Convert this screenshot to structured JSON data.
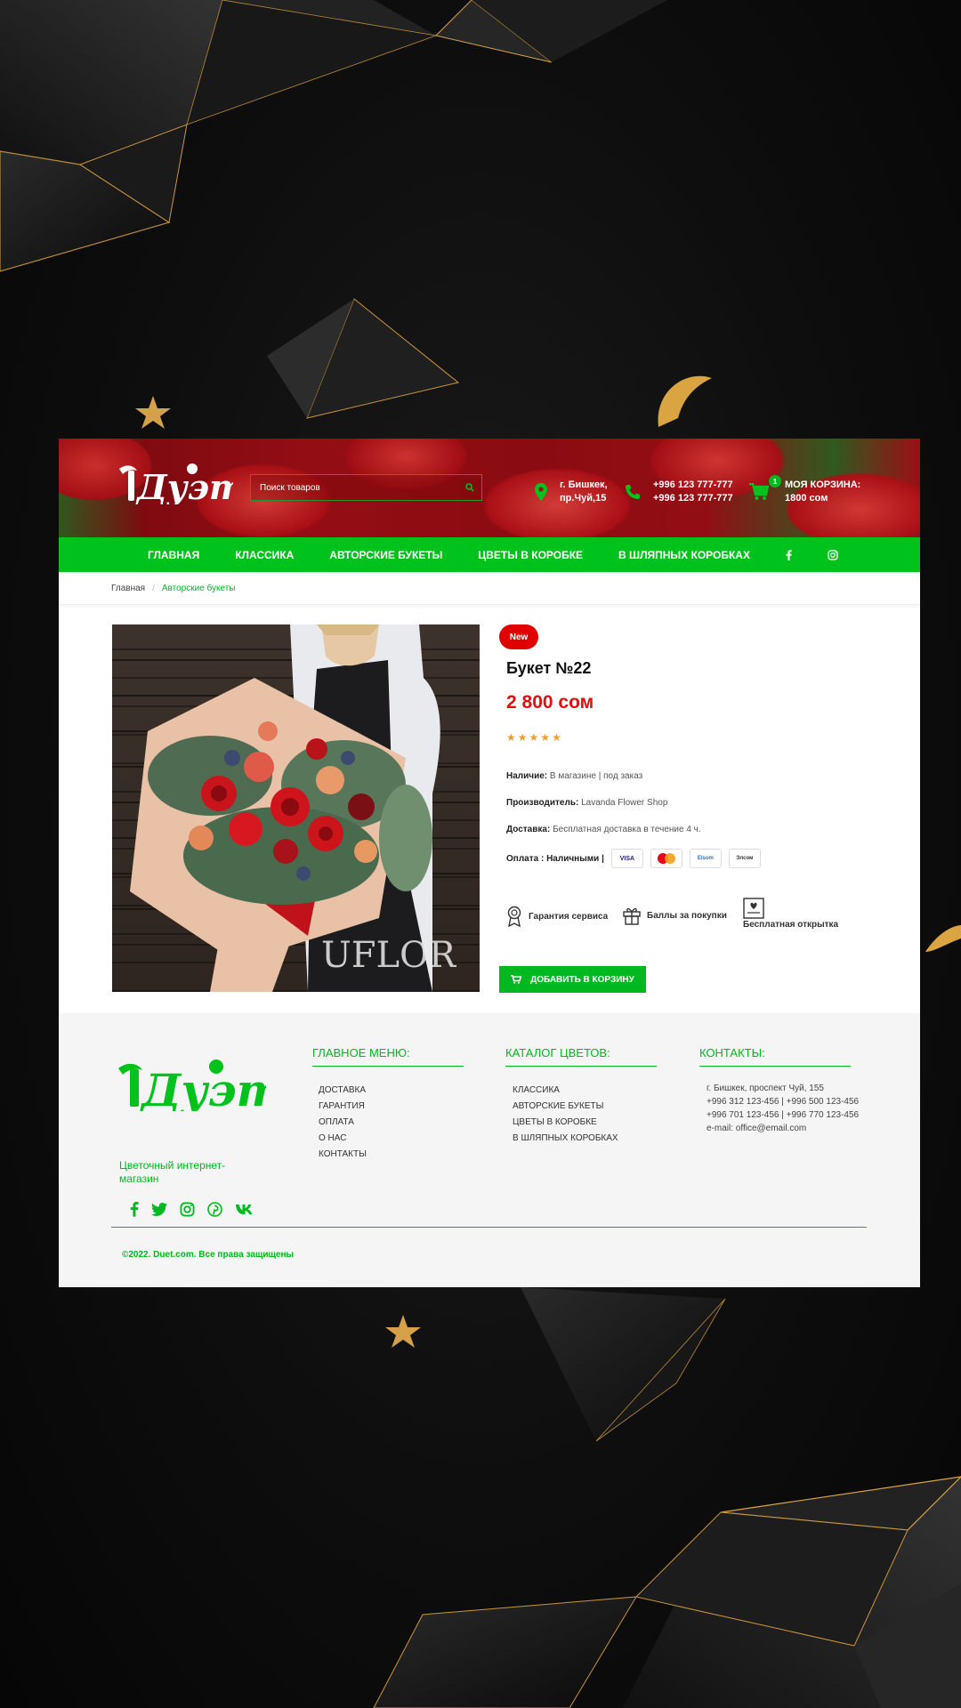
{
  "colors": {
    "accent": "#00c21c",
    "price": "#e01010",
    "badge": "#e00000",
    "gold": "#d9a441",
    "background": "#0e0e0e"
  },
  "header": {
    "logo_text": "Дуэт",
    "search_placeholder": "Поиск товаров",
    "address_line1": "г. Бишкек,",
    "address_line2": "пр.Чуй,15",
    "phone1": "+996 123 777-777",
    "phone2": "+996 123 777-777",
    "cart_title": "МОЯ КОРЗИНА:",
    "cart_total": "1800 сом",
    "cart_count": "1",
    "icons": [
      "search-icon",
      "map-pin-icon",
      "phone-icon",
      "cart-icon"
    ]
  },
  "nav": {
    "items": [
      "ГЛАВНАЯ",
      "КЛАССИКА",
      "АВТОРСКИЕ БУКЕТЫ",
      "ЦВЕТЫ В КОРОБКЕ",
      "В ШЛЯПНЫХ КОРОБКАХ"
    ],
    "social": [
      "facebook-icon",
      "instagram-icon"
    ]
  },
  "breadcrumb": {
    "home": "Главная",
    "current": "Авторские букеты"
  },
  "product": {
    "badge": "New",
    "title": "Букет №22",
    "price": "2 800 сом",
    "rating": 5,
    "availability_label": "Наличие:",
    "availability_value": "В магазине | под заказ",
    "maker_label": "Производитель:",
    "maker_value": "Lavanda Flower Shop",
    "delivery_label": "Доставка:",
    "delivery_value": "Бесплатная доставка в течение 4 ч.",
    "payment_label": "Оплата : Наличными |",
    "payment_methods": [
      "VISA",
      "MasterCard",
      "Elsom",
      "Элсом"
    ],
    "photo_watermark": "UFLOR",
    "features": [
      "Гарантия сервиса",
      "Баллы за покупки",
      "Бесплатная открытка"
    ],
    "add_to_cart": "ДОБАВИТЬ В КОРЗИНУ"
  },
  "footer": {
    "tagline": "Цветочный интернет-магазин",
    "menu_title": "ГЛАВНОЕ МЕНЮ:",
    "menu_items": [
      "ДОСТАВКА",
      "ГАРАНТИЯ",
      "ОПЛАТА",
      "О НАС",
      "КОНТАКТЫ"
    ],
    "catalog_title": "КАТАЛОГ ЦВЕТОВ:",
    "catalog_items": [
      "КЛАССИКА",
      "АВТОРСКИЕ БУКЕТЫ",
      "ЦВЕТЫ В КОРОБКЕ",
      "В ШЛЯПНЫХ КОРОБКАХ"
    ],
    "contacts_title": "КОНТАКТЫ:",
    "contacts": [
      "г. Бишкек, проспект Чуй, 155",
      "+996 312 123-456 | +996 500 123-456",
      "+996 701 123-456 | +996 770 123-456",
      "e-mail: office@email.com"
    ],
    "social": [
      "facebook-icon",
      "twitter-icon",
      "instagram-icon",
      "pinterest-icon",
      "vk-icon"
    ],
    "copyright": "©2022. Duet.com. Все права защищены"
  }
}
